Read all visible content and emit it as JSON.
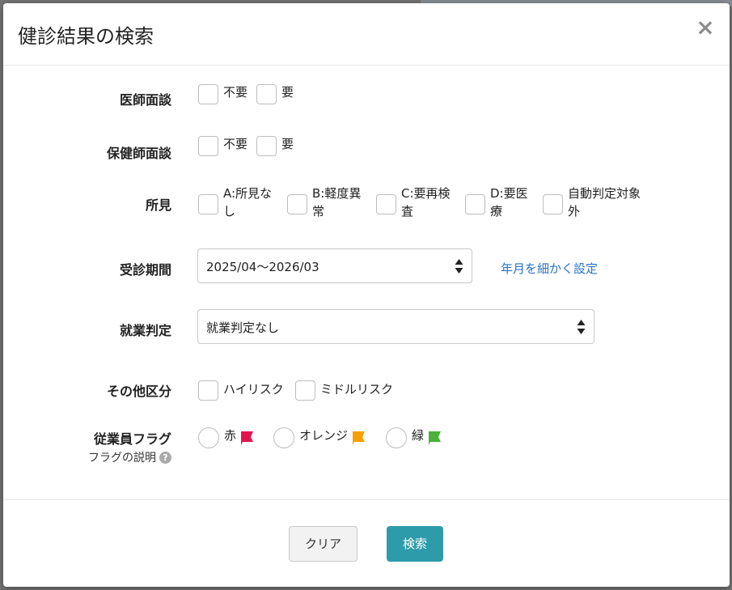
{
  "modal": {
    "title": "健診結果の検索",
    "close_label": "×"
  },
  "rows": {
    "doctor_interview": {
      "label": "医師面談",
      "options": [
        "不要",
        "要"
      ]
    },
    "nurse_interview": {
      "label": "保健師面談",
      "options": [
        "不要",
        "要"
      ]
    },
    "findings": {
      "label": "所見",
      "options": [
        {
          "line1": "A:所見な",
          "line2": "し"
        },
        {
          "line1": "B:軽度異",
          "line2": "常"
        },
        {
          "line1": "C:要再検",
          "line2": "査"
        },
        {
          "line1": "D:要医",
          "line2": "療"
        },
        {
          "line1": "自動判定対象",
          "line2": "外"
        }
      ]
    },
    "exam_period": {
      "label": "受診期間",
      "selected": "2025/04〜2026/03",
      "link": "年月を細かく設定"
    },
    "work_judgment": {
      "label": "就業判定",
      "selected": "就業判定なし"
    },
    "other_category": {
      "label": "その他区分",
      "options": [
        "ハイリスク",
        "ミドルリスク"
      ]
    },
    "employee_flag": {
      "label": "従業員フラグ",
      "help_text": "フラグの説明",
      "help_icon": "?",
      "options": [
        {
          "label": "赤",
          "color": "#e3154f"
        },
        {
          "label": "オレンジ",
          "color": "#f5a000"
        },
        {
          "label": "緑",
          "color": "#4caf3a"
        }
      ]
    }
  },
  "footer": {
    "clear_label": "クリア",
    "search_label": "検索"
  },
  "colors": {
    "primary_button": "#2e9bab",
    "link": "#2a72c8"
  }
}
